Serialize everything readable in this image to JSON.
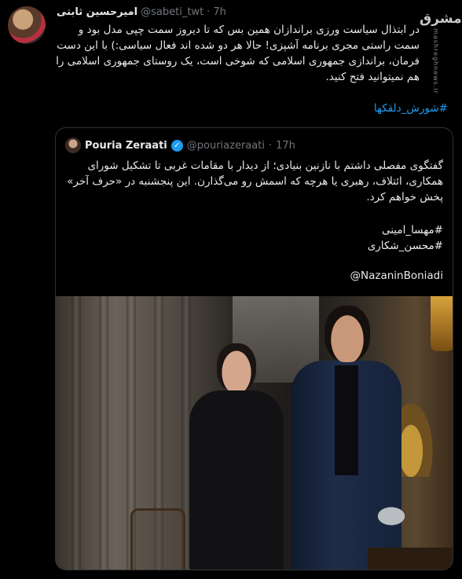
{
  "tweet": {
    "display_name": "امیرحسین ثابتی",
    "handle": "@sabeti_twt",
    "separator": "·",
    "time": "7h",
    "text": "در ابتذال سیاست ورزی براندازان همین بس که تا دیروز سمت چپی مدل بود و سمت راستی مجری برنامه آشپزی! حالا هر دو شده اند فعال سیاسی:) با این دست فرمان، براندازی جمهوری اسلامی که شوخی است، یک روستای جمهوری اسلامی را هم نمیتوانید فتح کنید.",
    "hashtag": "#شورش_دلقکها"
  },
  "watermark": {
    "logo_text": "مشرق",
    "sub_text": "mashreghnews.ir"
  },
  "quoted_tweet": {
    "display_name": "Pouria Zeraati",
    "verified_glyph": "✓",
    "handle": "@pouriazeraati",
    "separator": "·",
    "time": "17h",
    "text": "گفتگوی مفصلی داشتم با نازنین بنیادی؛ از دیدار با مقامات غربی تا تشکیل شورای همکاری، ائتلاف، رهبری یا هرچه که اسمش رو می‌گذارن. این پنجشنبه در «حرف آخر» پخش خواهم کرد.",
    "hashtags": [
      "#مهسا_امینی",
      "#محسن_شکاری"
    ],
    "mention": "@NazaninBoniadi"
  },
  "icons": {
    "verified": "verified-badge-icon"
  },
  "colors": {
    "background": "#000000",
    "text": "#e7e9ea",
    "muted": "#71767b",
    "link": "#1d9bf0",
    "border": "#2f3336"
  }
}
